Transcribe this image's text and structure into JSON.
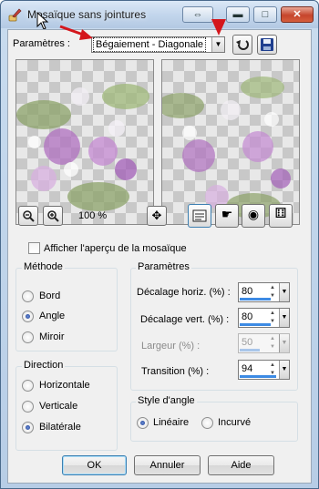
{
  "window": {
    "title": "Mosaïque sans jointures",
    "title_buttons": {
      "restore": "⇔",
      "minimize": "▬",
      "maximize": "□",
      "close": "✕"
    }
  },
  "params": {
    "label": "Paramètres :",
    "preset_value": "Bégaiement - Diagonale",
    "icons": {
      "reset": "undo-icon",
      "save": "floppy-disk-icon"
    }
  },
  "preview": {
    "zoom_label": "100 %",
    "icons": {
      "zoom_out": "zoom-out-icon",
      "zoom_in": "zoom-in-icon",
      "pan": "move-icon",
      "toggle_preview": "preview-window-icon",
      "hand": "hand-icon",
      "eye": "eye-icon",
      "randomize": "dice-icon"
    }
  },
  "tile_preview": {
    "label": "Afficher l'aperçu de la mosaïque",
    "checked": false
  },
  "methode": {
    "title": "Méthode",
    "options": [
      "Bord",
      "Angle",
      "Miroir"
    ],
    "selected": "Angle"
  },
  "direction": {
    "title": "Direction",
    "options": [
      "Horizontale",
      "Verticale",
      "Bilatérale"
    ],
    "selected": "Bilatérale"
  },
  "parametres": {
    "title": "Paramètres",
    "fields": [
      {
        "label": "Décalage horiz. (%) :",
        "value": "80",
        "level": 0.8,
        "enabled": true
      },
      {
        "label": "Décalage vert. (%) :",
        "value": "80",
        "level": 0.8,
        "enabled": true
      },
      {
        "label": "Largeur (%) :",
        "value": "50",
        "level": 0.5,
        "enabled": false
      },
      {
        "label": "Transition (%) :",
        "value": "94",
        "level": 0.94,
        "enabled": true
      }
    ]
  },
  "style_angle": {
    "title": "Style d'angle",
    "options": [
      "Linéaire",
      "Incurvé"
    ],
    "selected": "Linéaire"
  },
  "buttons": {
    "ok": "OK",
    "cancel": "Annuler",
    "help": "Aide"
  },
  "colors": {
    "accent": "#3d8be4",
    "annotation_arrow": "#d4161c"
  }
}
